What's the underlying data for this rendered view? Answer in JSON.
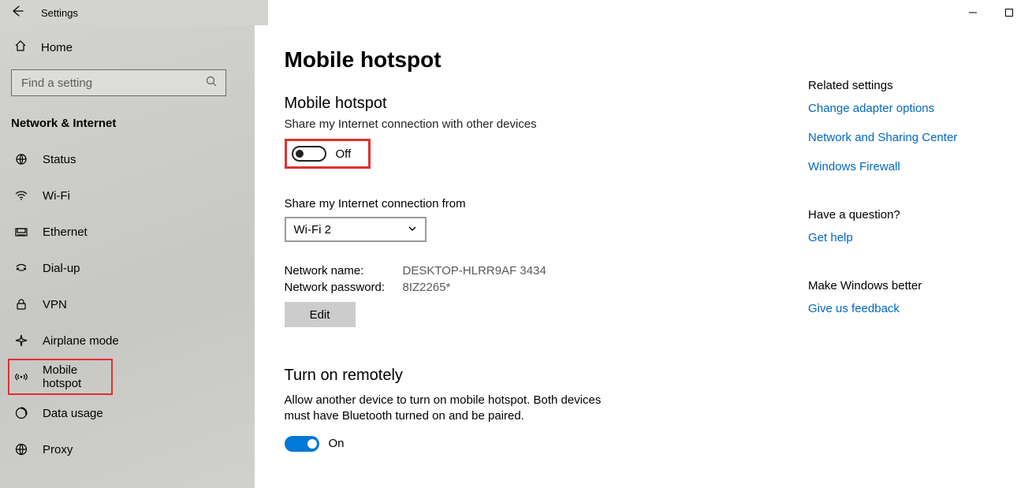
{
  "window": {
    "title": "Settings"
  },
  "sidebar": {
    "home_label": "Home",
    "search_placeholder": "Find a setting",
    "section_heading": "Network & Internet",
    "items": [
      {
        "label": "Status",
        "icon": "status-icon"
      },
      {
        "label": "Wi-Fi",
        "icon": "wifi-icon"
      },
      {
        "label": "Ethernet",
        "icon": "ethernet-icon"
      },
      {
        "label": "Dial-up",
        "icon": "dialup-icon"
      },
      {
        "label": "VPN",
        "icon": "vpn-icon"
      },
      {
        "label": "Airplane mode",
        "icon": "airplane-icon"
      },
      {
        "label": "Mobile hotspot",
        "icon": "hotspot-icon",
        "highlighted": true
      },
      {
        "label": "Data usage",
        "icon": "datausage-icon"
      },
      {
        "label": "Proxy",
        "icon": "proxy-icon"
      }
    ]
  },
  "page": {
    "title": "Mobile hotspot",
    "hotspot": {
      "heading": "Mobile hotspot",
      "description": "Share my Internet connection with other devices",
      "toggle_state": "Off"
    },
    "share_from": {
      "label": "Share my Internet connection from",
      "value": "Wi-Fi 2"
    },
    "details": {
      "name_label": "Network name:",
      "name_value": "DESKTOP-HLRR9AF 3434",
      "password_label": "Network password:",
      "password_value": "8IZ2265*",
      "edit_button": "Edit"
    },
    "remote": {
      "heading": "Turn on remotely",
      "description": "Allow another device to turn on mobile hotspot. Both devices must have Bluetooth turned on and be paired.",
      "toggle_state": "On"
    }
  },
  "rightcol": {
    "related_heading": "Related settings",
    "related_links": [
      "Change adapter options",
      "Network and Sharing Center",
      "Windows Firewall"
    ],
    "question_heading": "Have a question?",
    "help_link": "Get help",
    "better_heading": "Make Windows better",
    "feedback_link": "Give us feedback"
  }
}
